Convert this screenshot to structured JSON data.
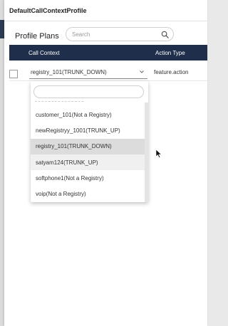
{
  "panel": {
    "title": "DefaultCallContextProfile"
  },
  "section": {
    "title": "Profile Plans",
    "search_placeholder": "Search"
  },
  "table": {
    "headers": [
      "Call Context",
      "Action Type"
    ],
    "row": {
      "call_context": "registry_101(TRUNK_DOWN)",
      "action_type": "feature.action"
    }
  },
  "dropdown": {
    "search_value": "",
    "partial_item": "~~~~~~~~~~~~~~~",
    "options": [
      "customer_101(Not a Registry)",
      "newRegistryy_1001(TRUNK_UP)",
      "registry_101(TRUNK_DOWN)",
      "satyam124(TRUNK_UP)",
      "softphone1(Not a Registry)",
      "voip(Not a Registry)"
    ],
    "selected_index": 2,
    "hover_index": 3
  },
  "colors": {
    "header_bg": "#1f2f4b",
    "selected_bg": "#dcdcdc"
  }
}
